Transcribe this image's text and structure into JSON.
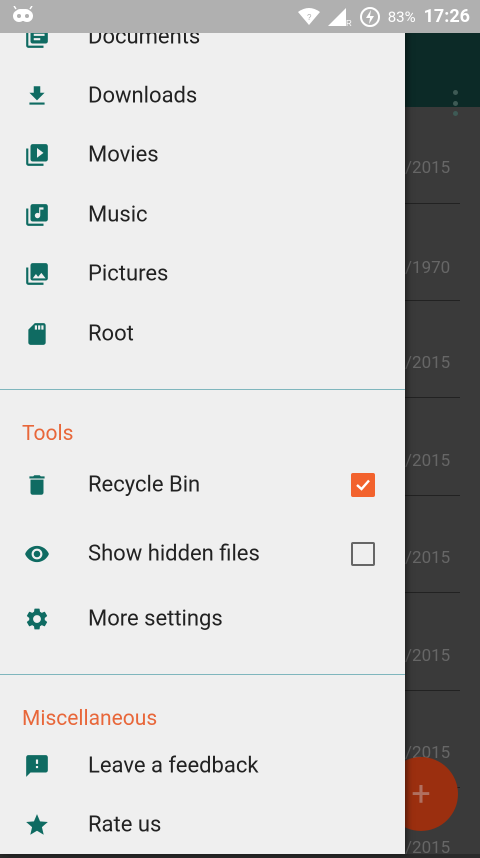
{
  "status_bar": {
    "battery": "83%",
    "time": "17:26"
  },
  "background": {
    "dates": [
      "/2015",
      "/1970",
      "/2015",
      "/2015",
      "/2015",
      "/2015",
      "/2015",
      "/2015"
    ]
  },
  "drawer": {
    "items": [
      {
        "label": "Documents",
        "icon": "documents-icon"
      },
      {
        "label": "Downloads",
        "icon": "download-icon"
      },
      {
        "label": "Movies",
        "icon": "movies-icon"
      },
      {
        "label": "Music",
        "icon": "music-icon"
      },
      {
        "label": "Pictures",
        "icon": "pictures-icon"
      },
      {
        "label": "Root",
        "icon": "sd-card-icon"
      }
    ],
    "tools_header": "Tools",
    "tools": [
      {
        "label": "Recycle Bin",
        "icon": "trash-icon",
        "checked": true
      },
      {
        "label": "Show hidden files",
        "icon": "eye-icon",
        "checked": false
      },
      {
        "label": "More settings",
        "icon": "gear-icon"
      }
    ],
    "misc_header": "Miscellaneous",
    "misc": [
      {
        "label": "Leave a feedback",
        "icon": "feedback-icon"
      },
      {
        "label": "Rate us",
        "icon": "star-icon"
      }
    ]
  },
  "fab_label": "+",
  "colors": {
    "accent": "#e8673a",
    "icon": "#0f6b62",
    "checkbox_on": "#f2622d"
  }
}
